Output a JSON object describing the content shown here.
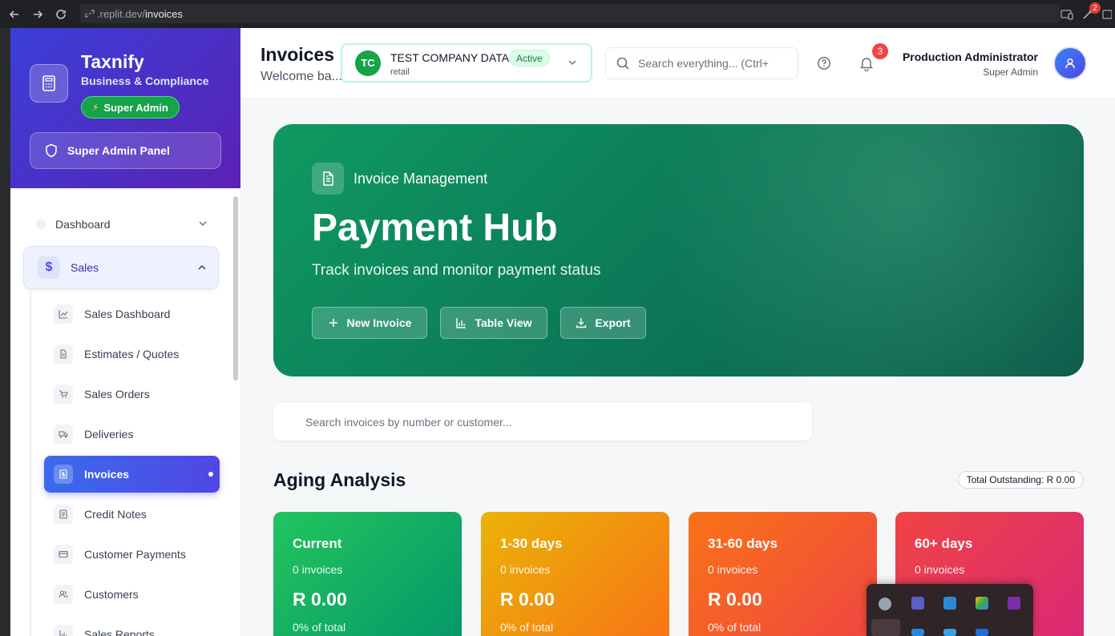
{
  "browser": {
    "url_domain": ".replit.dev/",
    "url_path": "invoices",
    "ext_badge": "2"
  },
  "sidebar": {
    "brand_name": "Taxnify",
    "brand_sub": "Business & Compliance",
    "role_pill": "Super Admin",
    "panel_button": "Super Admin Panel",
    "dashboard_label": "Dashboard",
    "sales_label": "Sales",
    "sales_icon": "$",
    "sub_items": [
      {
        "label": "Sales Dashboard",
        "icon": "chart-line-icon"
      },
      {
        "label": "Estimates / Quotes",
        "icon": "document-icon"
      },
      {
        "label": "Sales Orders",
        "icon": "cart-icon"
      },
      {
        "label": "Deliveries",
        "icon": "truck-icon"
      },
      {
        "label": "Invoices",
        "icon": "invoice-icon",
        "active": true
      },
      {
        "label": "Credit Notes",
        "icon": "credit-note-icon"
      },
      {
        "label": "Customer Payments",
        "icon": "card-icon"
      },
      {
        "label": "Customers",
        "icon": "users-icon"
      },
      {
        "label": "Sales Reports",
        "icon": "bar-chart-icon"
      }
    ]
  },
  "header": {
    "title": "Invoices",
    "subtitle": "Welcome ba...",
    "company_initials": "TC",
    "company_name": "TEST COMPANY DATA",
    "company_status": "Active",
    "company_type": "retail",
    "search_placeholder": "Search everything... (Ctrl+",
    "notifications_count": "3",
    "user_name": "Production Administrator",
    "user_role": "Super Admin"
  },
  "hero": {
    "eyebrow": "Invoice Management",
    "title": "Payment Hub",
    "subtitle": "Track invoices and monitor payment status",
    "new_invoice": "New Invoice",
    "table_view": "Table View",
    "export": "Export"
  },
  "invoice_search_placeholder": "Search invoices by number or customer...",
  "aging": {
    "title": "Aging Analysis",
    "total_outstanding": "Total Outstanding: R 0.00",
    "cards": [
      {
        "title": "Current",
        "count": "0 invoices",
        "amount": "R 0.00",
        "pct": "0% of total",
        "color_from": "#22c55e",
        "color_to": "#059669"
      },
      {
        "title": "1-30 days",
        "count": "0 invoices",
        "amount": "R 0.00",
        "pct": "0% of total",
        "color_from": "#eab308",
        "color_to": "#f97316"
      },
      {
        "title": "31-60 days",
        "count": "0 invoices",
        "amount": "R 0.00",
        "pct": "0% of total",
        "color_from": "#f97316",
        "color_to": "#ef4444"
      },
      {
        "title": "60+ days",
        "count": "0 invoices",
        "amount": "",
        "pct": "",
        "color_from": "#ef4444",
        "color_to": "#db2777"
      }
    ]
  },
  "colors": {
    "accent": "#4f46e5",
    "hero_green": "#0c7c59",
    "sidebar_head": "#4c2fc4"
  }
}
